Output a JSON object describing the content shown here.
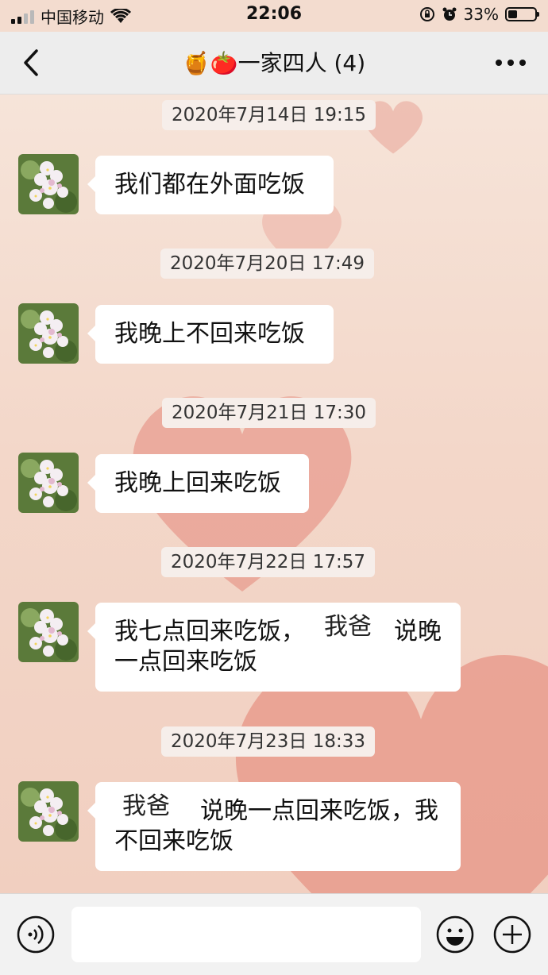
{
  "status_bar": {
    "carrier": "中国移动",
    "time": "22:06",
    "battery": "33%",
    "battery_level": 0.33
  },
  "nav": {
    "title": "🍯🍅一家四人 (4)"
  },
  "messages": [
    {
      "timestamp": "2020年7月14日 19:15",
      "text": "我们都在外面吃饭"
    },
    {
      "timestamp": "2020年7月20日 17:49",
      "text": "我晚上不回来吃饭"
    },
    {
      "timestamp": "2020年7月21日 17:30",
      "text": "我晚上回来吃饭"
    },
    {
      "timestamp": "2020年7月22日 17:57",
      "line1": "我七点回来吃饭，",
      "line1b": "说晚",
      "line2": "一点回来吃饭",
      "overlay": "我爸"
    },
    {
      "timestamp": "2020年7月23日 18:33",
      "line1": "说晚一点回来吃饭，我",
      "line2": "不回来吃饭",
      "overlay": "我爸"
    }
  ],
  "input": {
    "placeholder": ""
  },
  "icons": [
    "signal-icon",
    "wifi-icon",
    "lock-rotation-icon",
    "alarm-icon",
    "battery-icon",
    "back-arrow-icon",
    "more-icon",
    "voice-icon",
    "emoji-icon",
    "add-icon"
  ],
  "colors": {
    "bubble": "#ffffff",
    "navbar": "#ededed",
    "background": "#f3dccf"
  }
}
